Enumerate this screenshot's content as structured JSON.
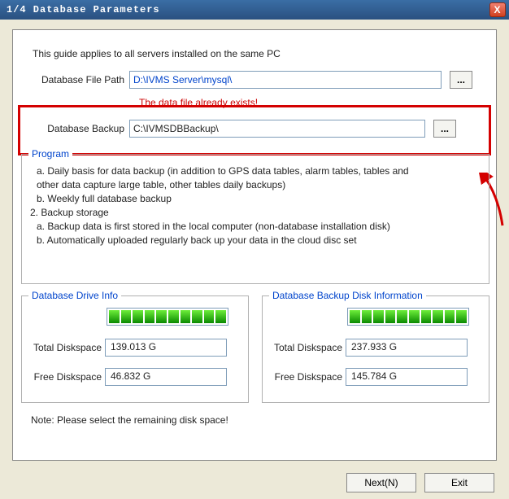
{
  "window": {
    "title": "1/4  Database Parameters",
    "close_icon": "X"
  },
  "intro": "This guide applies to all servers installed on the same PC",
  "file_path": {
    "label": "Database File Path",
    "value": "D:\\IVMS Server\\mysql\\",
    "browse": "..."
  },
  "exists_msg": "The data file already exists!",
  "backup_path": {
    "label": "Database Backup",
    "value": "C:\\IVMSDBBackup\\",
    "browse": "..."
  },
  "help": {
    "legend": "Program",
    "line1": "a. Daily basis for data backup (in addition to GPS data tables, alarm tables, tables and",
    "line2": "other data capture large table, other tables daily backups)",
    "line3": "b. Weekly full database backup",
    "line4": "2. Backup storage",
    "line5": "a. Backup data is first stored in the local computer (non-database installation disk)",
    "line6": "b. Automatically uploaded regularly back up your data in the cloud disc set"
  },
  "drive_info": {
    "legend": "Database Drive Info",
    "total_label": "Total Diskspace",
    "total_value": "139.013 G",
    "free_label": "Free Diskspace",
    "free_value": "46.832 G"
  },
  "backup_info": {
    "legend": "Database Backup Disk Information",
    "total_label": "Total Diskspace",
    "total_value": "237.933 G",
    "free_label": "Free Diskspace",
    "free_value": "145.784 G"
  },
  "note": "Note: Please select the remaining disk space!",
  "footer": {
    "next": "Next(N)",
    "exit": "Exit"
  }
}
